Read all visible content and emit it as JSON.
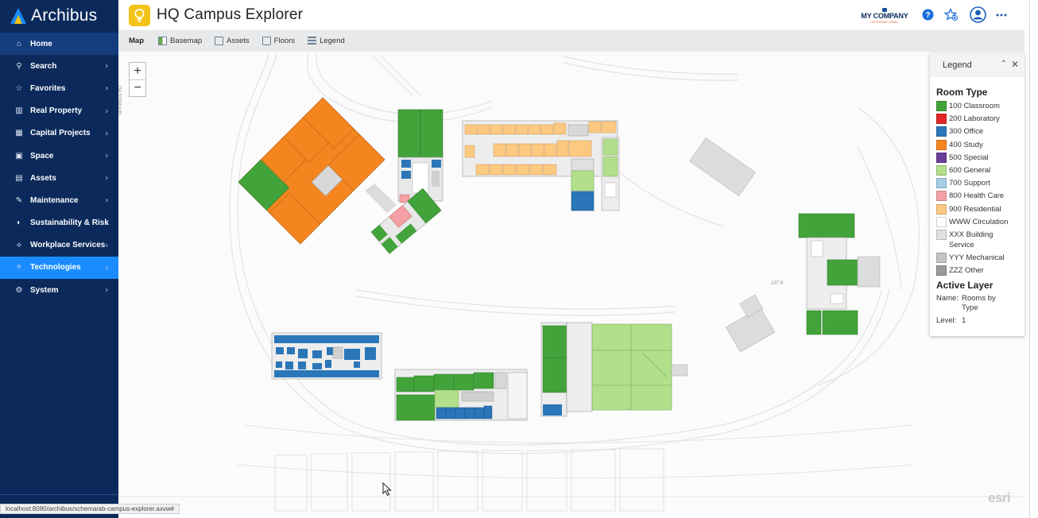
{
  "brand": {
    "name": "Archibus"
  },
  "nav": {
    "items": [
      {
        "label": "Home",
        "icon": "home-icon",
        "glyph": "⌂",
        "state": "home",
        "chevron": false
      },
      {
        "label": "Search",
        "icon": "search-icon",
        "glyph": "⚲",
        "state": "",
        "chevron": true
      },
      {
        "label": "Favorites",
        "icon": "star-icon",
        "glyph": "☆",
        "state": "",
        "chevron": true
      },
      {
        "label": "Real Property",
        "icon": "building-icon",
        "glyph": "▥",
        "state": "",
        "chevron": true
      },
      {
        "label": "Capital Projects",
        "icon": "money-icon",
        "glyph": "▦",
        "state": "",
        "chevron": true
      },
      {
        "label": "Space",
        "icon": "floorplan-icon",
        "glyph": "▣",
        "state": "",
        "chevron": true
      },
      {
        "label": "Assets",
        "icon": "clipboard-icon",
        "glyph": "▤",
        "state": "",
        "chevron": true
      },
      {
        "label": "Maintenance",
        "icon": "wrench-icon",
        "glyph": "✎",
        "state": "",
        "chevron": true
      },
      {
        "label": "Sustainability & Risk",
        "icon": "risk-icon",
        "glyph": "◐",
        "state": "",
        "chevron": true
      },
      {
        "label": "Workplace Services",
        "icon": "handshake-icon",
        "glyph": "⟡",
        "state": "",
        "chevron": true
      },
      {
        "label": "Technologies",
        "icon": "lightbulb-icon",
        "glyph": "✧",
        "state": "active",
        "chevron": true
      },
      {
        "label": "System",
        "icon": "gear-icon",
        "glyph": "⚙",
        "state": "",
        "chevron": true
      }
    ],
    "chevron_glyph": "›"
  },
  "header": {
    "title": "HQ Campus Explorer",
    "company_name": "MY COMPANY",
    "company_sub": "INTERNATIONAL",
    "help_icon": "help-icon",
    "favorite_icon": "star-plus-icon",
    "user_icon": "user-icon",
    "more_icon": "more-icon",
    "accent": "#1a8cff"
  },
  "toolbar": {
    "map_label": "Map",
    "basemap_label": "Basemap",
    "assets_label": "Assets",
    "floors_label": "Floors",
    "legend_label": "Legend"
  },
  "map": {
    "zoom_in": "+",
    "zoom_out": "−",
    "road_label": "SPRINGS RD",
    "distance_label": "237 ft",
    "attribution": "esri"
  },
  "legend": {
    "title": "Legend",
    "collapse_glyph": "⌃",
    "close_glyph": "✕",
    "room_type_title": "Room Type",
    "room_types": [
      {
        "label": "100 Classroom",
        "color": "#43a33b"
      },
      {
        "label": "200 Laboratory",
        "color": "#e02626"
      },
      {
        "label": "300 Office",
        "color": "#2b76b9"
      },
      {
        "label": "400 Study",
        "color": "#f5861f"
      },
      {
        "label": "500 Special",
        "color": "#6a3d9a"
      },
      {
        "label": "600 General",
        "color": "#b2df8a"
      },
      {
        "label": "700 Support",
        "color": "#a6cee3"
      },
      {
        "label": "800 Health Care",
        "color": "#f4a0a4"
      },
      {
        "label": "900 Residential",
        "color": "#fcc980"
      },
      {
        "label": "WWW Circulation",
        "color": "#ffffff"
      },
      {
        "label": "XXX Building Service",
        "color": "#e1e1e1"
      },
      {
        "label": "YYY Mechanical",
        "color": "#c4c4c4"
      },
      {
        "label": "ZZZ Other",
        "color": "#9a9a9a"
      }
    ],
    "active_layer_title": "Active Layer",
    "name_key": "Name:",
    "name_value": "Rooms by Type",
    "level_key": "Level:",
    "level_value": "1"
  },
  "status": {
    "url": "localhost:8080/archibus/schema/ab-campus-explorer.axvw#"
  }
}
